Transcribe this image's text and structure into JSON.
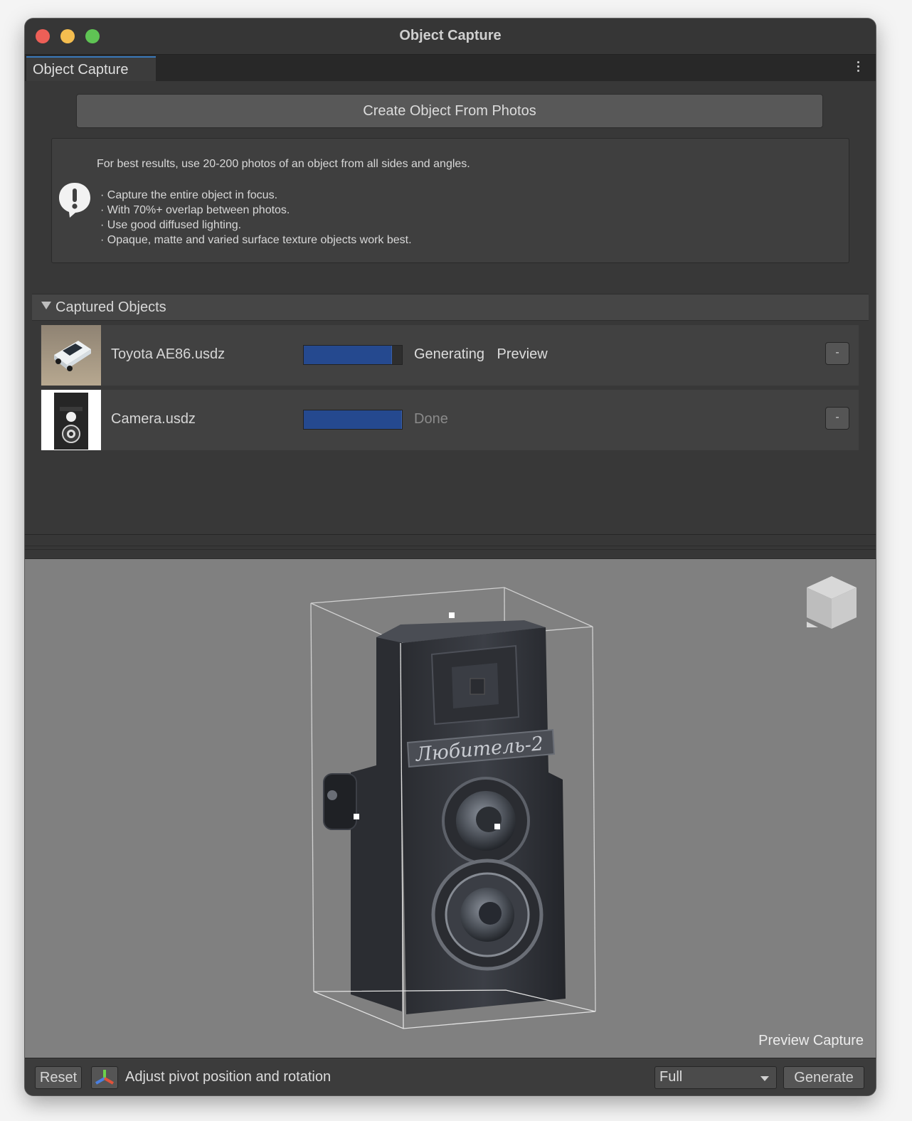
{
  "window": {
    "title": "Object Capture"
  },
  "tab": {
    "label": "Object Capture"
  },
  "create_button": "Create Object From Photos",
  "help": {
    "intro": "For best results, use 20-200 photos of an object from all sides and angles.",
    "bullets": [
      "· Capture the entire object in focus.",
      "· With 70%+ overlap between photos.",
      "· Use good diffused lighting.",
      "· Opaque, matte and varied surface texture objects work best."
    ]
  },
  "captured": {
    "header": "Captured Objects",
    "items": [
      {
        "name": "Toyota AE86.usdz",
        "progress": 0.9,
        "status": "Generating Preview",
        "remove_label": "-"
      },
      {
        "name": "Camera.usdz",
        "progress": 1.0,
        "status": "Done",
        "remove_label": "-"
      }
    ]
  },
  "viewport": {
    "caption": "Preview Capture",
    "model_label": "Любитель-2"
  },
  "bottom": {
    "reset": "Reset",
    "pivot_label": "Adjust pivot position and rotation",
    "quality": "Full",
    "generate": "Generate"
  },
  "colors": {
    "window_bg": "#383838",
    "progress_fill": "#25498f",
    "viewport_bg": "#808080",
    "close": "#ed5f57",
    "minimize": "#f4bd4f",
    "maximize": "#5fc454"
  }
}
